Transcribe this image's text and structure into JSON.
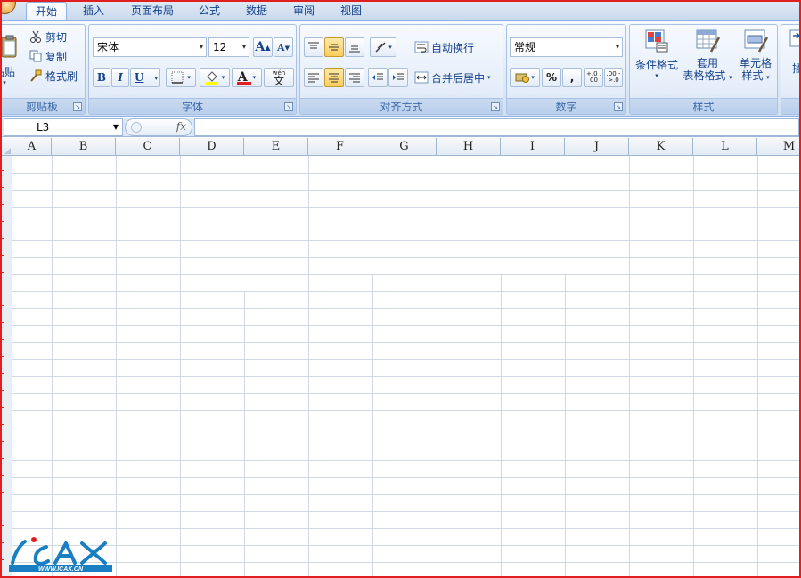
{
  "tabs": [
    {
      "label": "开始",
      "active": true
    },
    {
      "label": "插入",
      "active": false
    },
    {
      "label": "页面布局",
      "active": false
    },
    {
      "label": "公式",
      "active": false
    },
    {
      "label": "数据",
      "active": false
    },
    {
      "label": "审阅",
      "active": false
    },
    {
      "label": "视图",
      "active": false
    }
  ],
  "clipboard": {
    "title": "剪贴板",
    "paste_label": "粘贴",
    "cut_label": "剪切",
    "copy_label": "复制",
    "format_painter_label": "格式刷"
  },
  "font": {
    "title": "字体",
    "font_name": "宋体",
    "font_size": "12",
    "bold": "B",
    "italic": "I",
    "underline": "U",
    "grow": "A",
    "shrink": "A",
    "font_color_glyph": "A",
    "phonetic_top": "wén",
    "phonetic_glyph": "文"
  },
  "alignment": {
    "title": "对齐方式",
    "wrap_text_label": "自动换行",
    "merge_center_label": "合并后居中"
  },
  "number": {
    "title": "数字",
    "format": "常规",
    "percent": "%",
    "comma": ",",
    "inc_decimal": "+.0 .00",
    "dec_decimal": ".00 ->.0"
  },
  "styles": {
    "title": "样式",
    "conditional_label": "条件格式",
    "table_label_1": "套用",
    "table_label_2": "表格格式",
    "cell_style_label_1": "单元格",
    "cell_style_label_2": "样式"
  },
  "insert_partial": "插",
  "formula_bar": {
    "name_box": "L3",
    "fx": "fx"
  },
  "columns": [
    "A",
    "B",
    "C",
    "D",
    "E",
    "F",
    "G",
    "H",
    "I",
    "J",
    "K",
    "L",
    "M"
  ],
  "watermark": {
    "text": "WWW.ICAX.CN",
    "colors": {
      "primary": "#1a7fc2",
      "accent": "#e02020"
    }
  },
  "colors": {
    "frame": "#e02020",
    "ribbon_text": "#15428b",
    "font_color_bar": "#e02020",
    "highlight_bar": "#ffff00"
  }
}
